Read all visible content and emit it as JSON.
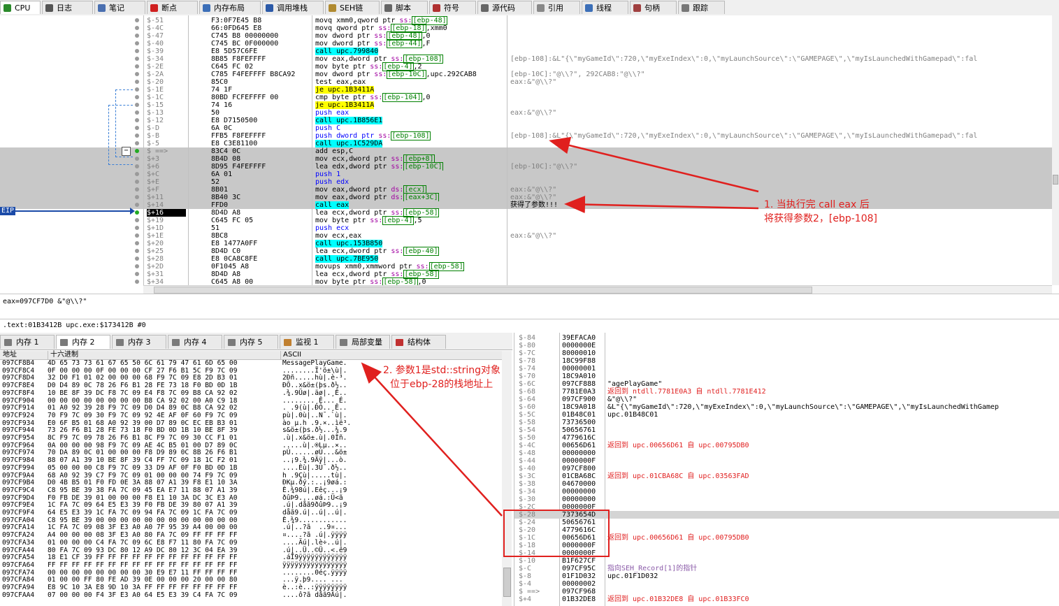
{
  "toolbar": {
    "tabs": [
      {
        "label": "CPU",
        "icon": "cpu-icon",
        "active": true
      },
      {
        "label": "日志",
        "icon": "log-icon"
      },
      {
        "label": "笔记",
        "icon": "notes-icon"
      },
      {
        "label": "断点",
        "icon": "breakpoint-icon"
      },
      {
        "label": "内存布局",
        "icon": "memory-map-icon"
      },
      {
        "label": "调用堆栈",
        "icon": "call-stack-icon"
      },
      {
        "label": "SEH链",
        "icon": "seh-icon"
      },
      {
        "label": "脚本",
        "icon": "script-icon"
      },
      {
        "label": "符号",
        "icon": "symbol-icon"
      },
      {
        "label": "源代码",
        "icon": "source-icon"
      },
      {
        "label": "引用",
        "icon": "references-icon"
      },
      {
        "label": "线程",
        "icon": "threads-icon"
      },
      {
        "label": "句柄",
        "icon": "handles-icon"
      },
      {
        "label": "跟踪",
        "icon": "trace-icon"
      }
    ]
  },
  "disasm": {
    "eip_label": "EIP",
    "rows": [
      {
        "addr": "$-51",
        "bytes": "F3:0F7E45 B8",
        "ins": [
          [
            "movq xmm0,qword ptr ",
            "mov"
          ],
          [
            "ss:",
            "seg"
          ],
          [
            "[ebp-48]",
            "ptr"
          ]
        ],
        "cmt": ""
      },
      {
        "addr": "$-4C",
        "bytes": "66:0FD645 E8",
        "ins": [
          [
            "movq qword ptr ",
            "mov"
          ],
          [
            "ss:",
            "seg"
          ],
          [
            "[ebp-18]",
            "ptr"
          ],
          [
            ",xmm0",
            "mov"
          ]
        ],
        "cmt": ""
      },
      {
        "addr": "$-47",
        "bytes": "C745 B8 00000000",
        "ins": [
          [
            "mov dword ptr ",
            "mov"
          ],
          [
            "ss:",
            "seg"
          ],
          [
            "[ebp-48]",
            "ptr"
          ],
          [
            ",0",
            "mov"
          ]
        ],
        "cmt": ""
      },
      {
        "addr": "$-40",
        "bytes": "C745 BC 0F000000",
        "ins": [
          [
            "mov dword ptr ",
            "mov"
          ],
          [
            "ss:",
            "seg"
          ],
          [
            "[ebp-44]",
            "ptr"
          ],
          [
            ",F",
            "mov"
          ]
        ],
        "cmt": ""
      },
      {
        "addr": "$-39",
        "bytes": "E8 5D57C6FE",
        "ins": [
          [
            "call upc.799840",
            "call"
          ]
        ],
        "cmt": ""
      },
      {
        "addr": "$-34",
        "bytes": "8B85 F8FEFFFF",
        "ins": [
          [
            "mov eax,dword ptr ",
            "mov"
          ],
          [
            "ss:",
            "seg"
          ],
          [
            "[ebp-108]",
            "ptr"
          ]
        ],
        "cmt": "[ebp-108]:&L\"{\\\"myGameId\\\":720,\\\"myExeIndex\\\":0,\\\"myLaunchSource\\\":\\\"GAMEPAGE\\\",\\\"myIsLaunchedWithGamepad\\\":fal"
      },
      {
        "addr": "$-2E",
        "bytes": "C645 FC 02",
        "ins": [
          [
            "mov byte ptr ",
            "mov"
          ],
          [
            "ss:",
            "seg"
          ],
          [
            "[ebp-4]",
            "ptr"
          ],
          [
            ",2",
            "mov"
          ]
        ],
        "cmt": ""
      },
      {
        "addr": "$-2A",
        "bytes": "C785 F4FEFFFF B8CA92",
        "ins": [
          [
            "mov dword ptr ",
            "mov"
          ],
          [
            "ss:",
            "seg"
          ],
          [
            "[ebp-10C]",
            "ptr"
          ],
          [
            ",upc.292CAB8",
            "mov"
          ]
        ],
        "cmt": "[ebp-10C]:\"@\\\\?\", 292CAB8:\"@\\\\?\""
      },
      {
        "addr": "$-20",
        "bytes": "85C0",
        "ins": [
          [
            "test eax,eax",
            "mov"
          ]
        ],
        "cmt": "eax:&\"@\\\\?\""
      },
      {
        "addr": "$-1E",
        "bytes": "74 1F",
        "ins": [
          [
            "je upc.1B3411A",
            "je"
          ]
        ],
        "cmt": ""
      },
      {
        "addr": "$-1C",
        "bytes": "80BD FCFEFFFF 00",
        "ins": [
          [
            "cmp byte ptr ",
            "mov"
          ],
          [
            "ss:",
            "seg"
          ],
          [
            "[ebp-104]",
            "ptr"
          ],
          [
            ",0",
            "mov"
          ]
        ],
        "cmt": ""
      },
      {
        "addr": "$-15",
        "bytes": "74 16",
        "ins": [
          [
            "je upc.1B3411A",
            "je"
          ]
        ],
        "cmt": ""
      },
      {
        "addr": "$-13",
        "bytes": "50",
        "ins": [
          [
            "push eax",
            "push"
          ]
        ],
        "cmt": "eax:&\"@\\\\?\""
      },
      {
        "addr": "$-12",
        "bytes": "E8 D7150500",
        "ins": [
          [
            "call upc.1B856E1",
            "call"
          ]
        ],
        "cmt": ""
      },
      {
        "addr": "$-D",
        "bytes": "6A 0C",
        "ins": [
          [
            "push C",
            "push"
          ]
        ],
        "cmt": ""
      },
      {
        "addr": "$-B",
        "bytes": "FFB5 F8FEFFFF",
        "ins": [
          [
            "push dword ptr ",
            "push"
          ],
          [
            "ss:",
            "seg"
          ],
          [
            "[ebp-108]",
            "ptr"
          ]
        ],
        "cmt": "[ebp-108]:&L\"{\\\"myGameId\\\":720,\\\"myExeIndex\\\":0,\\\"myLaunchSource\\\":\\\"GAMEPAGE\\\",\\\"myIsLaunchedWithGamepad\\\":fal"
      },
      {
        "addr": "$-5",
        "bytes": "E8 C3E81100",
        "ins": [
          [
            "call upc.1C529DA",
            "call"
          ]
        ],
        "cmt": ""
      },
      {
        "addr": "$ ==>",
        "bytes": "83C4 0C",
        "ins": [
          [
            "add esp,C",
            "mov"
          ]
        ],
        "cmt": "",
        "hl": true,
        "cur": true
      },
      {
        "addr": "$+3",
        "bytes": "8B4D 08",
        "ins": [
          [
            "mov ecx,dword ptr ",
            "mov"
          ],
          [
            "ss:",
            "seg"
          ],
          [
            "[ebp+8]",
            "ptr"
          ]
        ],
        "cmt": "",
        "hl": true
      },
      {
        "addr": "$+6",
        "bytes": "8D95 F4FEFFFF",
        "ins": [
          [
            "lea edx,dword ptr ",
            "mov"
          ],
          [
            "ss:",
            "seg"
          ],
          [
            "[ebp-10C]",
            "ptr"
          ]
        ],
        "cmt": "[ebp-10C]:\"@\\\\?\"",
        "hl": true
      },
      {
        "addr": "$+C",
        "bytes": "6A 01",
        "ins": [
          [
            "push 1",
            "push"
          ]
        ],
        "cmt": "",
        "hl": true
      },
      {
        "addr": "$+E",
        "bytes": "52",
        "ins": [
          [
            "push edx",
            "push"
          ]
        ],
        "cmt": "",
        "hl": true
      },
      {
        "addr": "$+F",
        "bytes": "8B01",
        "ins": [
          [
            "mov eax,dword ptr ",
            "mov"
          ],
          [
            "ds:",
            "seg"
          ],
          [
            "[ecx]",
            "ptr"
          ]
        ],
        "cmt": "eax:&\"@\\\\?\"",
        "hl": true
      },
      {
        "addr": "$+11",
        "bytes": "8B40 3C",
        "ins": [
          [
            "mov eax,dword ptr ",
            "mov"
          ],
          [
            "ds:",
            "seg"
          ],
          [
            "[eax+3C]",
            "ptr"
          ]
        ],
        "cmt": "eax:&\"@\\\\?\"",
        "hl": true
      },
      {
        "addr": "$+14",
        "bytes": "FFD0",
        "ins": [
          [
            "call eax",
            "call"
          ]
        ],
        "cmt": "获得了参数!!!",
        "hl": true
      },
      {
        "addr": "$+16",
        "bytes": "8D4D A8",
        "ins": [
          [
            "lea ecx,dword ptr ",
            "mov"
          ],
          [
            "ss:",
            "seg"
          ],
          [
            "[ebp-58]",
            "ptr"
          ]
        ],
        "cmt": "",
        "eip": true
      },
      {
        "addr": "$+19",
        "bytes": "C645 FC 05",
        "ins": [
          [
            "mov byte ptr ",
            "mov"
          ],
          [
            "ss:",
            "seg"
          ],
          [
            "[ebp-4]",
            "ptr"
          ],
          [
            ",5",
            "mov"
          ]
        ],
        "cmt": ""
      },
      {
        "addr": "$+1D",
        "bytes": "51",
        "ins": [
          [
            "push ecx",
            "push"
          ]
        ],
        "cmt": ""
      },
      {
        "addr": "$+1E",
        "bytes": "8BC8",
        "ins": [
          [
            "mov ecx,eax",
            "mov"
          ]
        ],
        "cmt": "eax:&\"@\\\\?\""
      },
      {
        "addr": "$+20",
        "bytes": "E8 1477A0FF",
        "ins": [
          [
            "call upc.153B850",
            "call"
          ]
        ],
        "cmt": ""
      },
      {
        "addr": "$+25",
        "bytes": "8D4D C0",
        "ins": [
          [
            "lea ecx,dword ptr ",
            "mov"
          ],
          [
            "ss:",
            "seg"
          ],
          [
            "[ebp-40]",
            "ptr"
          ]
        ],
        "cmt": ""
      },
      {
        "addr": "$+28",
        "bytes": "E8 0CA8C8FE",
        "ins": [
          [
            "call upc.7BE950",
            "call"
          ]
        ],
        "cmt": ""
      },
      {
        "addr": "$+2D",
        "bytes": "0F1045 A8",
        "ins": [
          [
            "movups xmm0,xmmword ptr ",
            "mov"
          ],
          [
            "ss:",
            "seg"
          ],
          [
            "[ebp-58]",
            "ptr"
          ]
        ],
        "cmt": ""
      },
      {
        "addr": "$+31",
        "bytes": "8D4D A8",
        "ins": [
          [
            "lea ecx,dword ptr ",
            "mov"
          ],
          [
            "ss:",
            "seg"
          ],
          [
            "[ebp-58]",
            "ptr"
          ]
        ],
        "cmt": ""
      },
      {
        "addr": "$+34",
        "bytes": "C645 A8 00",
        "ins": [
          [
            "mov byte ptr ",
            "mov"
          ],
          [
            "ss:",
            "seg"
          ],
          [
            "[ebp-58]",
            "ptr"
          ],
          [
            ",0",
            "mov"
          ]
        ],
        "cmt": ""
      }
    ]
  },
  "info": {
    "line1": "eax=097CF7D0 &\"@\\\\?\"",
    "line2": ".text:01B3412B upc.exe:$173412B #0"
  },
  "memtabs": [
    {
      "label": "内存 1"
    },
    {
      "label": "内存 2",
      "active": true
    },
    {
      "label": "内存 3"
    },
    {
      "label": "内存 4"
    },
    {
      "label": "内存 5"
    },
    {
      "label": "监视 1"
    },
    {
      "label": "局部变量"
    },
    {
      "label": "结构体"
    }
  ],
  "dump": {
    "headers": {
      "addr": "地址",
      "hex": "十六进制",
      "ascii": "ASCII"
    },
    "rows": [
      {
        "a": "097CF8B4",
        "h": "4D 65 73 73 61 67 65 50 6C 61 79 47 61 6D 65 00",
        "s": "MessagePlayGame."
      },
      {
        "a": "097CF8C4",
        "h": "0F 00 00 00 0F 00 00 00 CF 27 F6 B1 5C F9 7C 09",
        "s": "........Ï'ö±\\ù|."
      },
      {
        "a": "097CF8D4",
        "h": "32 D0 F1 01 02 00 00 00 68 F9 7C 09 E8 2D B3 01",
        "s": "2Ðñ.....hù|.è-³."
      },
      {
        "a": "097CF8E4",
        "h": "D0 D4 89 0C 78 26 F6 B1 28 FE 73 18 F0 BD 0D 1B",
        "s": "ÐÔ..x&ö±(þs.ð½.."
      },
      {
        "a": "097CF8F4",
        "h": "10 BE 8F 39 DC F8 7C 09 E4 F8 7C 09 B8 CA 92 02",
        "s": ".¾.9Üø|.äø|.¸Ê.."
      },
      {
        "a": "097CF904",
        "h": "00 00 00 00 00 00 00 00 B8 CA 92 02 00 A0 C9 18",
        "s": "........¸Ê... É."
      },
      {
        "a": "097CF914",
        "h": "01 A0 92 39 28 F9 7C 09 D0 D4 89 0C B8 CA 92 02",
        "s": ". .9(ù|.ÐÔ..¸Ê.."
      },
      {
        "a": "097CF924",
        "h": "70 F9 7C 09 30 F9 7C 09 92 4E AF 0F 60 F9 7C 09",
        "s": "pù|.0ù|..N¯.`ù|."
      },
      {
        "a": "097CF934",
        "h": "E0 6F B5 01 68 A0 92 39 00 D7 89 0C EC EB B3 01",
        "s": "ào µ.h .9.×..ìë³."
      },
      {
        "a": "097CF944",
        "h": "73 26 F6 B1 28 FE 73 18 F0 BD 0D 1B 10 BE 8F 39",
        "s": "s&ö±(þs.ð½...¾.9"
      },
      {
        "a": "097CF954",
        "h": "8C F9 7C 09 78 26 F6 B1 8C F9 7C 09 30 CC F1 01",
        "s": ".ù|.x&ö±.ù|.0Ìñ."
      },
      {
        "a": "097CF964",
        "h": "0A 00 00 00 98 F9 7C 09 AE 4C B5 01 00 D7 89 0C",
        "s": ".....ù|.®Lµ..×.."
      },
      {
        "a": "097CF974",
        "h": "70 DA 89 0C 01 00 00 00 F8 D9 89 0C 8B 26 F6 B1",
        "s": "pÚ......øÙ...&ö±"
      },
      {
        "a": "097CF984",
        "h": "88 07 A1 39 10 BE 8F 39 C4 FF 7C 09 18 1C F2 01",
        "s": "..¡9.¾.9Äÿ|...ò."
      },
      {
        "a": "097CF994",
        "h": "05 00 00 00 C8 F9 7C 09 33 D9 AF 0F F0 BD 0D 1B",
        "s": "....Èù|.3Ù¯.ð½.."
      },
      {
        "a": "097CF9A4",
        "h": "68 A0 92 39 C7 F9 7C 09 01 00 00 00 74 F9 7C 09",
        "s": "h .9Çù|.....tù|."
      },
      {
        "a": "097CF9B4",
        "h": "D0 4B B5 01 F0 FD 0E 3A 88 07 A1 39 F8 E1 10 3A",
        "s": "ÐKµ.ðý.:..¡9øá.:"
      },
      {
        "a": "097CF9C4",
        "h": "C8 95 BE 39 38 FA 7C 09 45 EA E7 11 88 07 A1 39",
        "s": "È.¾98ú|.Eêç...¡9"
      },
      {
        "a": "097CF9D4",
        "h": "F0 FB DE 39 01 00 00 00 F8 E1 10 3A DC 3C E3 A0",
        "s": "ðûÞ9....øá.:Ü<ã "
      },
      {
        "a": "097CF9E4",
        "h": "1C FA 7C 09 64 E5 E3 39 F0 FB DE 39 80 07 A1 39",
        "s": ".ú|.dåã9ðûÞ9..¡9"
      },
      {
        "a": "097CF9F4",
        "h": "64 E5 E3 39 1C FA 7C 09 94 FA 7C 09 1C FA 7C 09",
        "s": "dåã9.ú|..ú|..ú|."
      },
      {
        "a": "097CFA04",
        "h": "C8 95 BE 39 00 00 00 00 00 00 00 00 00 00 00 00",
        "s": "È.¾9............"
      },
      {
        "a": "097CFA14",
        "h": "1C FA 7C 09 08 3F E3 A0 A0 7F 95 39 A4 00 00 00",
        "s": ".ú|..?ã  ..9¤..."
      },
      {
        "a": "097CFA24",
        "h": "A4 00 00 00 08 3F E3 A0 80 FA 7C 09 FF FF FF FF",
        "s": "¤....?ã .ú|.ÿÿÿÿ"
      },
      {
        "a": "097CFA34",
        "h": "01 00 00 00 C4 FA 7C 09 6C E8 F7 11 80 FA 7C 09",
        "s": "....Äú|.lè÷..ú|."
      },
      {
        "a": "097CFA44",
        "h": "80 FA 7C 09 93 DC 80 12 A9 DC 80 12 3C 04 EA 39",
        "s": ".ú|..Ü..©Ü..<.ê9"
      },
      {
        "a": "097CFA54",
        "h": "18 E1 CF 39 FF FF FF FF FF FF FF FF FF FF FF FF",
        "s": ".áÏ9ÿÿÿÿÿÿÿÿÿÿÿÿ"
      },
      {
        "a": "097CFA64",
        "h": "FF FF FF FF FF FF FF FF FF FF FF FF FF FF FF FF",
        "s": "ÿÿÿÿÿÿÿÿÿÿÿÿÿÿÿÿ"
      },
      {
        "a": "097CFA74",
        "h": "00 00 00 00 00 00 00 00 30 E9 E7 11 FF FF FF FF",
        "s": "........0éç.ÿÿÿÿ"
      },
      {
        "a": "097CFA84",
        "h": "01 00 00 FF 80 FE AD 39 0E 00 00 00 20 00 00 80",
        "s": "...ÿ.þ­9.... ..."
      },
      {
        "a": "097CFA94",
        "h": "E8 9C 10 3A E8 9D 10 3A FF FF FF FF FF FF FF FF",
        "s": "è..:è..:ÿÿÿÿÿÿÿÿ"
      },
      {
        "a": "097CFAA4",
        "h": "07 00 00 00 F4 3F E3 A0 64 E5 E3 39 C4 FA 7C 09",
        "s": "....ô?ã dåã9Äú|."
      }
    ]
  },
  "stack": {
    "rows": [
      {
        "o": "$-84",
        "v": "39EFACA0",
        "c": ""
      },
      {
        "o": "$-80",
        "v": "0000000E",
        "c": ""
      },
      {
        "o": "$-7C",
        "v": "80000010",
        "c": ""
      },
      {
        "o": "$-78",
        "v": "18C99F88",
        "c": ""
      },
      {
        "o": "$-74",
        "v": "00000001",
        "c": ""
      },
      {
        "o": "$-70",
        "v": "18C9A010",
        "c": ""
      },
      {
        "o": "$-6C",
        "v": "097CF888",
        "c": "\"agePlayGame\""
      },
      {
        "o": "$-68",
        "v": "7781E0A3",
        "c": "返回到 ntdll.7781E0A3 自 ntdll.7781E412",
        "red": true
      },
      {
        "o": "$-64",
        "v": "097CF900",
        "c": "&\"@\\\\?\""
      },
      {
        "o": "$-60",
        "v": "18C9A018",
        "c": "&L\"{\\\"myGameId\\\":720,\\\"myExeIndex\\\":0,\\\"myLaunchSource\\\":\\\"GAMEPAGE\\\",\\\"myIsLaunchedWithGamep"
      },
      {
        "o": "$-5C",
        "v": "01B48C01",
        "c": "upc.01B48C01"
      },
      {
        "o": "$-58",
        "v": "73736500",
        "c": ""
      },
      {
        "o": "$-54",
        "v": "50656761",
        "c": ""
      },
      {
        "o": "$-50",
        "v": "4779616C",
        "c": ""
      },
      {
        "o": "$-4C",
        "v": "00656D61",
        "c": "返回到 upc.00656D61 自 upc.00795DB0",
        "red": true
      },
      {
        "o": "$-48",
        "v": "00000000",
        "c": ""
      },
      {
        "o": "$-44",
        "v": "0000000F",
        "c": ""
      },
      {
        "o": "$-40",
        "v": "097CF800",
        "c": ""
      },
      {
        "o": "$-3C",
        "v": "01CBA68C",
        "c": "返回到 upc.01CBA68C 自 upc.03563FAD",
        "red": true
      },
      {
        "o": "$-38",
        "v": "04670000",
        "c": ""
      },
      {
        "o": "$-34",
        "v": "00000000",
        "c": ""
      },
      {
        "o": "$-30",
        "v": "00000000",
        "c": ""
      },
      {
        "o": "$-2C",
        "v": "0000000F",
        "c": ""
      },
      {
        "o": "$-28",
        "v": "7373654D",
        "c": "",
        "hl": true
      },
      {
        "o": "$-24",
        "v": "50656761",
        "c": ""
      },
      {
        "o": "$-20",
        "v": "4779616C",
        "c": ""
      },
      {
        "o": "$-1C",
        "v": "00656D61",
        "c": "返回到 upc.00656D61 自 upc.00795DB0",
        "red": true
      },
      {
        "o": "$-18",
        "v": "0000000F",
        "c": ""
      },
      {
        "o": "$-14",
        "v": "0000000F",
        "c": ""
      },
      {
        "o": "$-10",
        "v": "B1F627CF",
        "c": ""
      },
      {
        "o": "$-C",
        "v": "097CF95C",
        "c": "指向SEH_Record[1]的指针",
        "seh": true
      },
      {
        "o": "$-8",
        "v": "01F1D032",
        "c": "upc.01F1D032"
      },
      {
        "o": "$-4",
        "v": "00000002",
        "c": ""
      },
      {
        "o": "$ ==>",
        "v": "097CF968",
        "c": ""
      },
      {
        "o": "$+4",
        "v": "01B32DE8",
        "c": "返回到 upc.01B32DE8 自 upc.01B33FC0",
        "red": true
      }
    ]
  },
  "annotations": {
    "a1_line1": "1. 当执行完 call eax 后",
    "a1_line2": "将获得参数2，[ebp-108]",
    "a2_line1": "2. 参数1是std::string对象",
    "a2_line2": "位于ebp-28的栈地址上"
  },
  "colors": {
    "accent": "#e0201e",
    "call": "#00ffff",
    "jump": "#ffff00",
    "eip": "#1b4ba8"
  }
}
